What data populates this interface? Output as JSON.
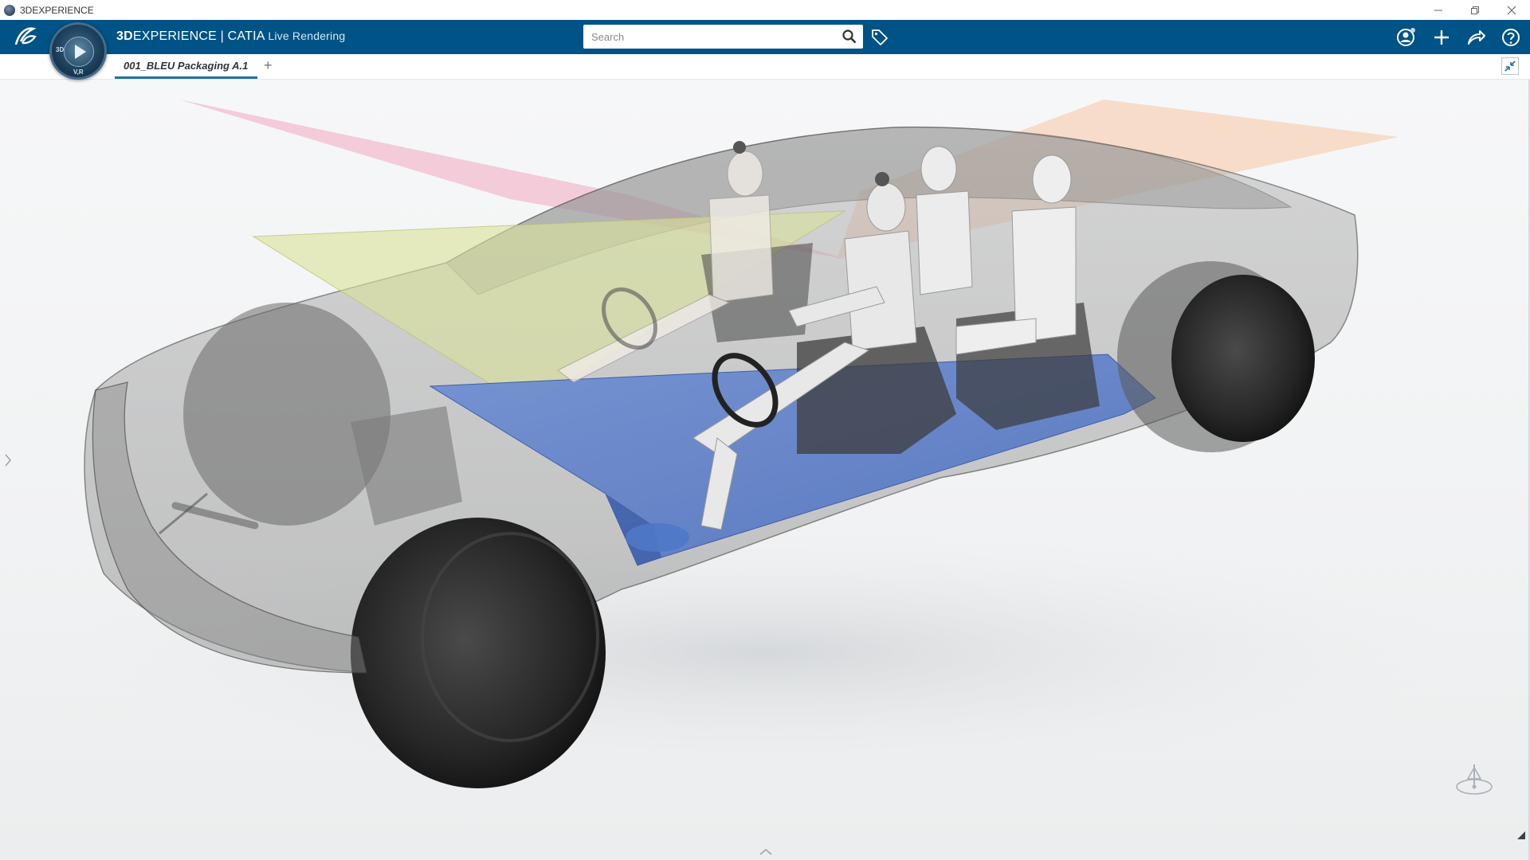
{
  "window": {
    "title": "3DEXPERIENCE",
    "controls": [
      "minimize",
      "restore",
      "close"
    ]
  },
  "header": {
    "brand_bold": "3D",
    "brand_rest": "EXPERIENCE",
    "separator": " | ",
    "app": "CATIA",
    "role": "Live Rendering",
    "search_placeholder": "Search",
    "icons": [
      "ds-logo-icon",
      "compass-icon",
      "search-icon",
      "tag-icon",
      "user-icon",
      "add-icon",
      "share-icon",
      "help-icon"
    ]
  },
  "compass": {
    "quadrant_labels": [
      "3D",
      "V,R"
    ]
  },
  "tabs": [
    {
      "label": "001_BLEU Packaging A.1",
      "active": true
    }
  ],
  "tab_add_label": "+",
  "scene": {
    "description_visible": false,
    "colors": {
      "battery_floor": "#5b7ec9",
      "pink_plane": "#f2a7c0",
      "yellow_plane": "#d9e199",
      "orange_plane": "#f7c6a6",
      "tire": "#2a2a2a",
      "body_glass": "#9a9a9a"
    }
  },
  "colors": {
    "header_bg": "#005386",
    "tab_underline": "#1f70a8"
  }
}
